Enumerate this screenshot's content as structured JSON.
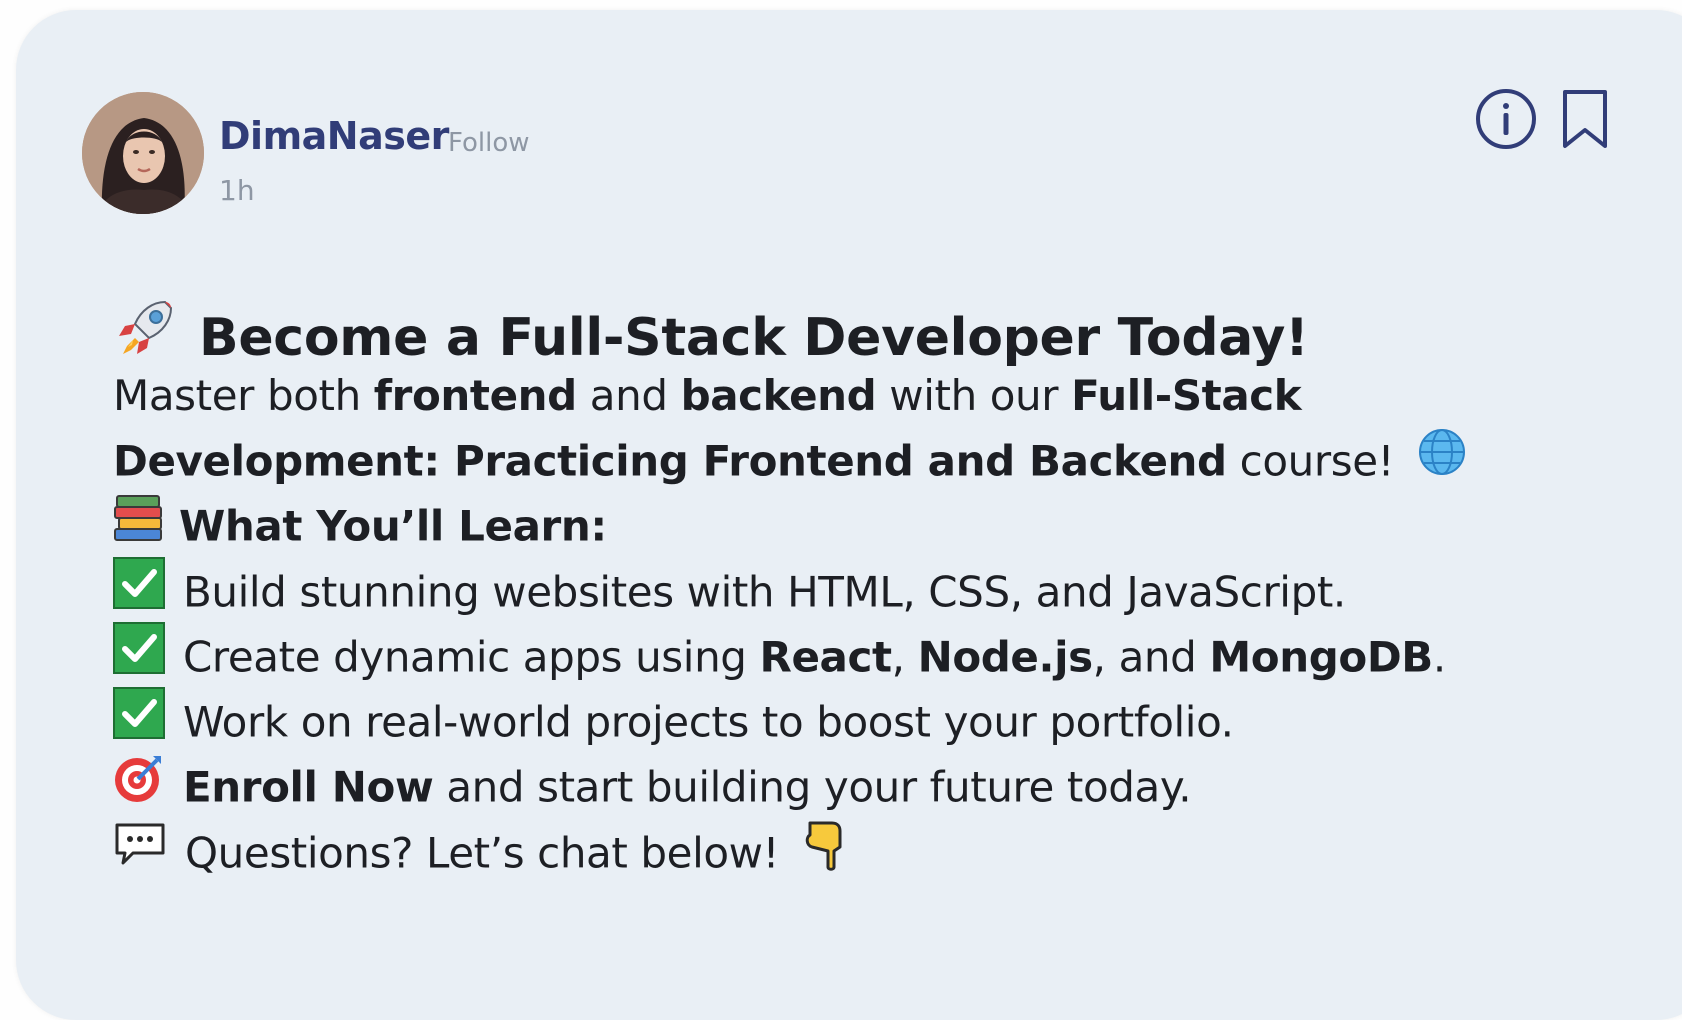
{
  "post": {
    "author": {
      "name": "DimaNaser",
      "follow_label": "Follow",
      "time_ago": "1h"
    },
    "actions": {
      "info_icon": "info-circle-icon",
      "bookmark_icon": "bookmark-icon"
    },
    "content": {
      "headline": "Become a Full-Stack Developer Today!",
      "intro": {
        "t1": "Master both ",
        "b1": "frontend",
        "t2": " and ",
        "b2": "backend",
        "t3": " with our ",
        "b3": "Full-Stack",
        "b4": "Development: Practicing Frontend and Backend",
        "t4": " course!"
      },
      "learn_heading": "What You’ll Learn:",
      "bullets": {
        "b1": "Build stunning websites with HTML, CSS, and JavaScript.",
        "b2_t1": "Create dynamic apps using ",
        "b2_b1": "React",
        "b2_t2": ", ",
        "b2_b2": "Node.js",
        "b2_t3": ", and ",
        "b2_b3": "MongoDB",
        "b2_t4": ".",
        "b3": "Work on real-world projects to boost your portfolio."
      },
      "enroll": {
        "bold": "Enroll Now",
        "rest": " and start building your future today."
      },
      "questions": "Questions? Let’s chat below!"
    },
    "icons": {
      "headline": "rocket-icon",
      "globe": "globe-icon",
      "books": "books-icon",
      "check": "check-mark-icon",
      "target": "target-icon",
      "chat": "speech-bubble-icon",
      "pointing": "pointing-down-icon"
    }
  }
}
